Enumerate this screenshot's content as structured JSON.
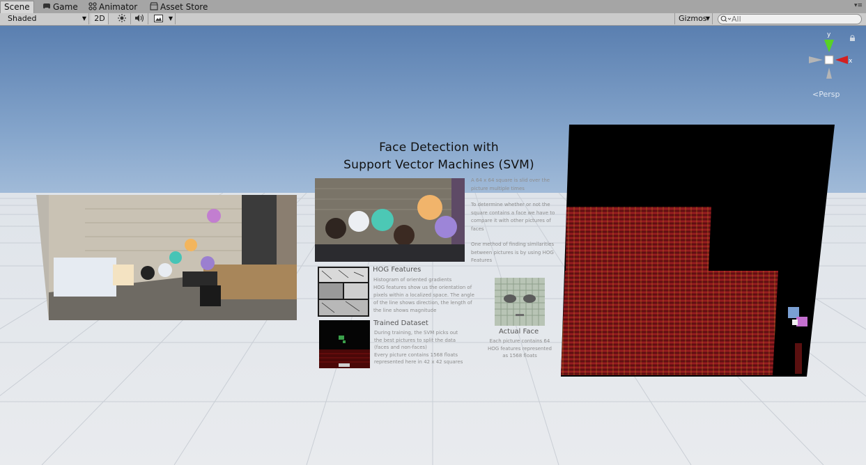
{
  "tabs": [
    {
      "label": "Scene",
      "icon": "scene-icon",
      "active": true
    },
    {
      "label": "Game",
      "icon": "game-controller-icon",
      "active": false
    },
    {
      "label": "Animator",
      "icon": "animator-icon",
      "active": false
    },
    {
      "label": "Asset Store",
      "icon": "asset-store-icon",
      "active": false
    }
  ],
  "toolbar": {
    "shading_mode": "Shaded",
    "mode_2d": "2D",
    "gizmos_label": "Gizmos",
    "search_placeholder": "All"
  },
  "gizmo": {
    "axis_y": "y",
    "axis_x": "x",
    "projection": "Persp"
  },
  "scene_panel": {
    "title_line1": "Face Detection with",
    "title_line2": "Support Vector Machines (SVM)",
    "intro_p1_l1": "A 64 x 64 square is slid over the",
    "intro_p1_l2": "picture multiple times",
    "intro_p2_l1": "To determine whether or not the",
    "intro_p2_l2": "square contains a face we have to",
    "intro_p2_l3": "compare it with other pictures of",
    "intro_p2_l4": "faces",
    "intro_p3_l1": "One method of finding similarities",
    "intro_p3_l2": "between pictures is by using HOG",
    "intro_p3_l3": "Features",
    "hog_heading": "HOG Features",
    "hog_l1": "Histogram of oriented gradients",
    "hog_l2": "HOG features show us the orientation of",
    "hog_l3": "pixels within a localized space. The angle",
    "hog_l4": "of the line shows direction, the length of",
    "hog_l5": "the line shows magnitude",
    "dataset_heading": "Trained Dataset",
    "dataset_l1": "During training, the SVM picks out",
    "dataset_l2": "the best pictures to split the data",
    "dataset_l3": "(faces and non-faces)",
    "dataset_l4": "Every picture contains 1568 floats",
    "dataset_l5": "represented here in 42 x 42 squares",
    "face_heading": "Actual Face",
    "face_l1": "Each picture contains 64",
    "face_l2": "HOG features represented",
    "face_l3": "as 1568 floats"
  },
  "colors": {
    "sky_top": "#5a7fb0",
    "ground": "#e4e7eb",
    "gizmo_y": "#58d225",
    "gizmo_x": "#d42020"
  }
}
